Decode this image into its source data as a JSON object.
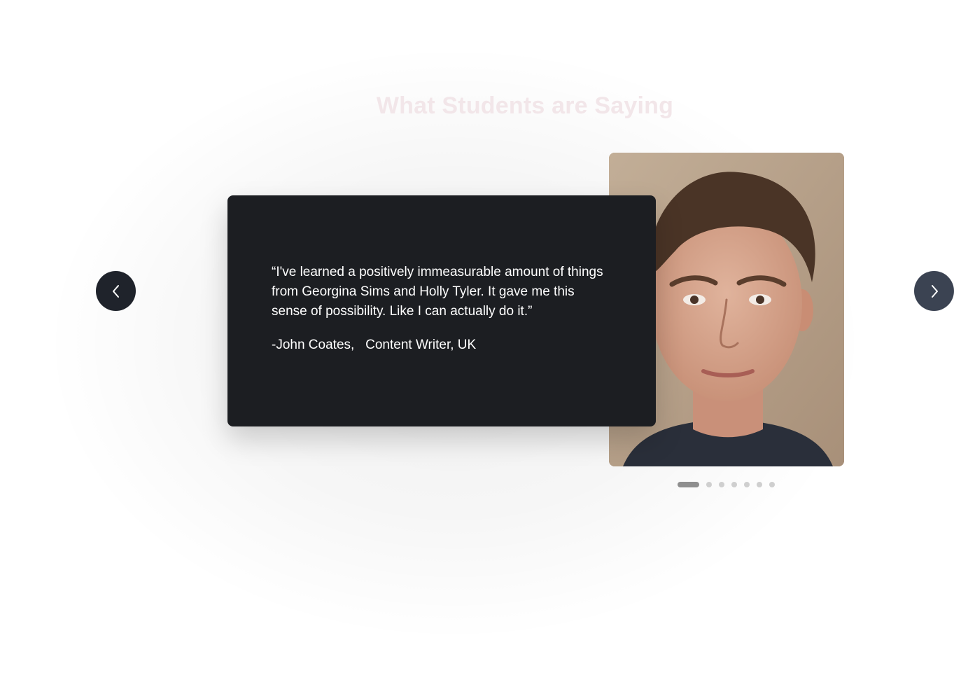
{
  "section": {
    "title": "What Students are Saying"
  },
  "testimonial": {
    "quote": "“I've learned a positively immeasurable amount of things from Georgina Sims and Holly Tyler. It gave me this sense of possibility. Like I can actually do it.”",
    "author": "-John Coates,",
    "role": "Content Writer, UK"
  },
  "carousel": {
    "prev_icon": "chevron-left-icon",
    "next_icon": "chevron-right-icon",
    "slide_count": 7,
    "active_index": 0
  },
  "colors": {
    "card_bg": "#1c1e22",
    "title": "#f2e6e9",
    "prev_button": "#1f232b",
    "next_button": "#3b4352",
    "dot_active": "#8e8e8e",
    "dot_inactive": "#cfcfcf"
  }
}
